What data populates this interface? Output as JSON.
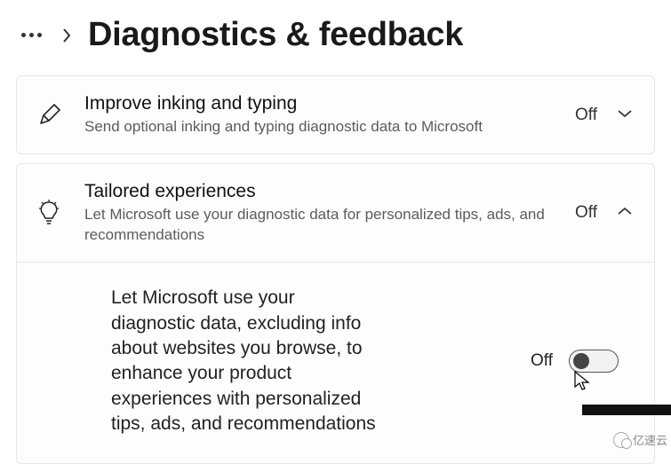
{
  "header": {
    "title": "Diagnostics & feedback"
  },
  "cards": {
    "inking": {
      "title": "Improve inking and typing",
      "subtitle": "Send optional inking and typing diagnostic data to Microsoft",
      "state": "Off"
    },
    "tailored": {
      "title": "Tailored experiences",
      "subtitle": "Let Microsoft use your diagnostic data for personalized tips, ads, and recommendations",
      "state": "Off",
      "body": "Let Microsoft use your diagnostic data, excluding info about websites you browse, to enhance your product experiences with personalized tips, ads, and recommendations",
      "toggle_label": "Off",
      "toggle_value": false
    }
  },
  "watermark": {
    "text": "亿速云"
  }
}
